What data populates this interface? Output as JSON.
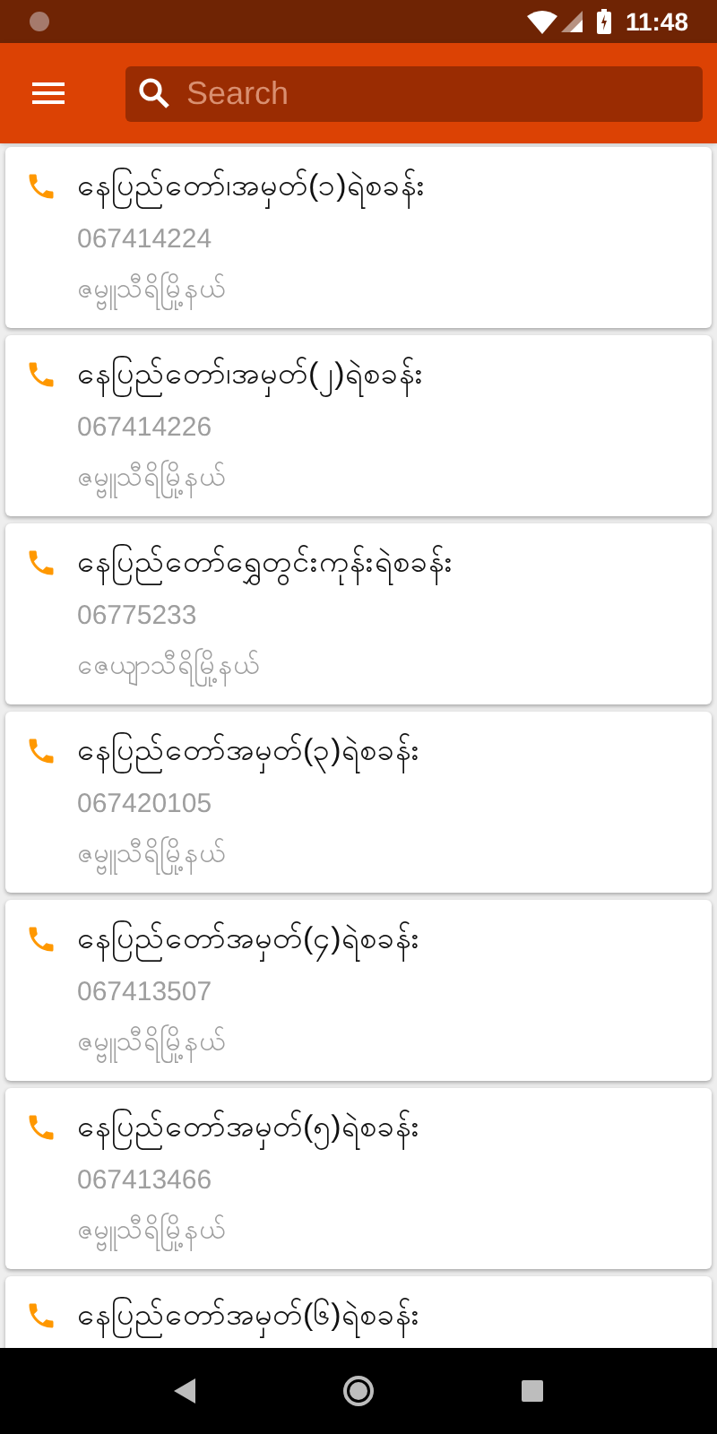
{
  "status_bar": {
    "time": "11:48"
  },
  "search": {
    "placeholder": "Search"
  },
  "stations": [
    {
      "name": "နေပြည်တော်၊အမှတ်(၁)ရဲစခန်း",
      "phone": "067414224",
      "township": "ဇမ္ဗူသီရိမြို့နယ်"
    },
    {
      "name": "နေပြည်တော်၊အမှတ်(၂)ရဲစခန်း",
      "phone": "067414226",
      "township": "ဇမ္ဗူသီရိမြို့နယ်"
    },
    {
      "name": "နေပြည်တော်ရွှေတွင်းကုန်းရဲစခန်း",
      "phone": "06775233",
      "township": "ဇေယျာသီရိမြို့နယ်"
    },
    {
      "name": "နေပြည်တော်အမှတ်(၃)ရဲစခန်း",
      "phone": "067420105",
      "township": "ဇမ္ဗူသီရိမြို့နယ်"
    },
    {
      "name": "နေပြည်တော်အမှတ်(၄)ရဲစခန်း",
      "phone": "067413507",
      "township": "ဇမ္ဗူသီရိမြို့နယ်"
    },
    {
      "name": "နေပြည်တော်အမှတ်(၅)ရဲစခန်း",
      "phone": "067413466",
      "township": "ဇမ္ဗူသီရိမြို့နယ်"
    },
    {
      "name": "နေပြည်တော်အမှတ်(၆)ရဲစခန်း"
    }
  ]
}
